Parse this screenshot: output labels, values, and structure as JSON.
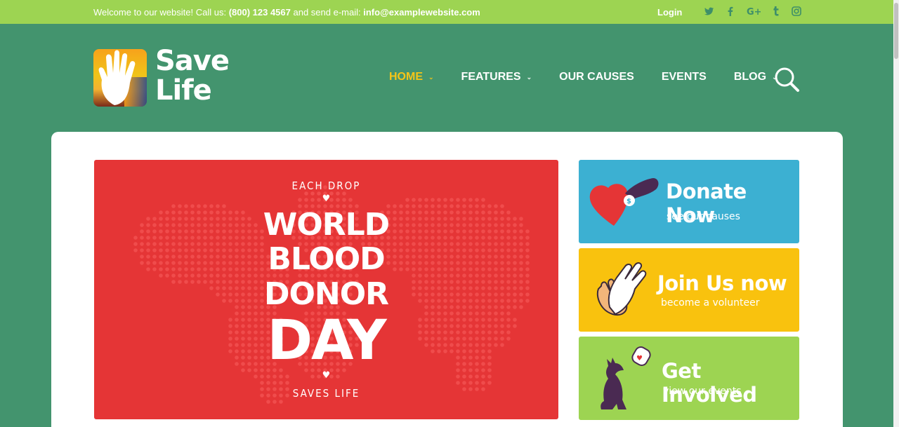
{
  "topbar": {
    "welcome_prefix": "Welcome to our website! Call us:",
    "phone": "(800) 123 4567",
    "welcome_middle": "and send e-mail:",
    "email": "info@examplewebsite.com",
    "login": "Login",
    "social_icons": [
      "twitter-icon",
      "facebook-icon",
      "google-plus-icon",
      "tumblr-icon",
      "instagram-icon"
    ]
  },
  "logo": {
    "line1": "Save",
    "line2": "Life"
  },
  "nav": {
    "items": [
      {
        "label": "HOME",
        "has_dropdown": true,
        "active": true
      },
      {
        "label": "FEATURES",
        "has_dropdown": true,
        "active": false
      },
      {
        "label": "OUR CAUSES",
        "has_dropdown": false,
        "active": false
      },
      {
        "label": "EVENTS",
        "has_dropdown": false,
        "active": false
      },
      {
        "label": "BLOG",
        "has_dropdown": true,
        "active": false
      }
    ]
  },
  "banner": {
    "top": "EACH DROP",
    "line1": "WORLD",
    "line2": "BLOOD",
    "line3": "DONOR",
    "line4": "DAY",
    "bottom": "SAVES LIFE"
  },
  "side_cards": [
    {
      "title": "Donate Now",
      "subtitle": "see our causes",
      "color": "#3cb0d2",
      "icon": "heart-donation-icon"
    },
    {
      "title": "Join Us now",
      "subtitle": "become a volunteer",
      "color": "#f9c20e",
      "icon": "hands-icon"
    },
    {
      "title": "Get Involved",
      "subtitle": "view our events",
      "color": "#9dd452",
      "icon": "dog-icon"
    }
  ],
  "colors": {
    "header_bg": "#43946e",
    "topbar_bg": "#9dd452",
    "accent": "#f5c518",
    "banner_red": "#e53536"
  }
}
